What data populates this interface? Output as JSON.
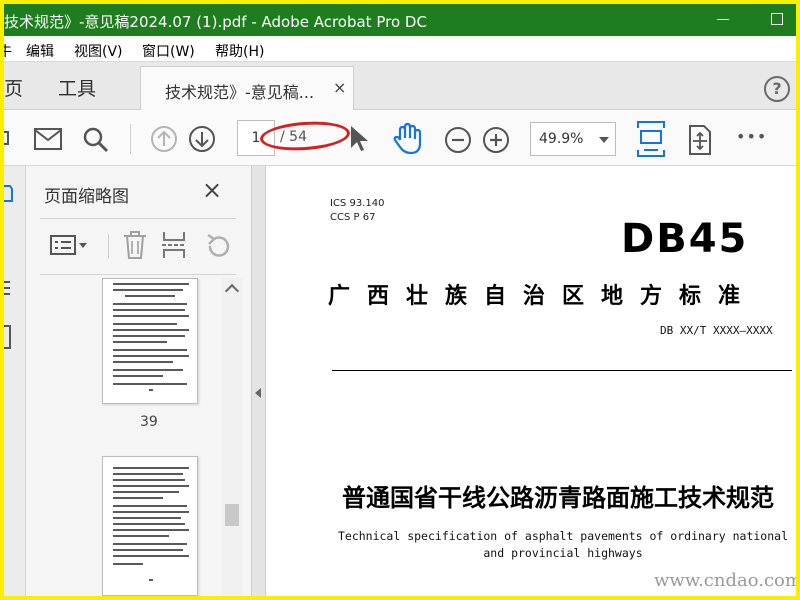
{
  "window": {
    "title": "技术规范》-意见稿2024.07 (1).pdf - Adobe Acrobat Pro DC"
  },
  "menu": {
    "items": [
      "编辑",
      "视图(V)",
      "窗口(W)",
      "帮助(H)"
    ],
    "partial_left": "牛"
  },
  "tabs": {
    "home": "页",
    "tools": "工具",
    "document": "技术规范》-意见稿...",
    "close": "×",
    "help": "?"
  },
  "toolbar": {
    "current_page": "1",
    "total_pages": "/ 54",
    "zoom": "49.9%",
    "more": "•••",
    "icons": [
      "print-icon",
      "email-icon",
      "search-icon",
      "prev-page-icon",
      "next-page-icon",
      "select-cursor-icon",
      "hand-tool-icon",
      "zoom-out-icon",
      "zoom-in-icon",
      "fit-page-icon",
      "scroll-mode-icon",
      "more-icon"
    ]
  },
  "thumbnails": {
    "title": "页面缩略图",
    "close": "×",
    "page_label": "39"
  },
  "document": {
    "ics": "ICS  93.140",
    "ccs": "CCS  P 67",
    "logo": "DB45",
    "standard_title": "广西壮族自治区地方标准",
    "standard_code": "DB XX/T XXXX—XXXX",
    "main_title": "普通国省干线公路沥青路面施工技术规范",
    "english_title": "Technical specification of asphalt pavements  of ordinary national and provincial highways"
  },
  "watermark": "www.cndao.com",
  "colors": {
    "titlebar": "#1e7d1e",
    "accent_blue": "#1473e6",
    "annotation_red": "#d81f1f",
    "frame_yellow": "#f9f000"
  }
}
